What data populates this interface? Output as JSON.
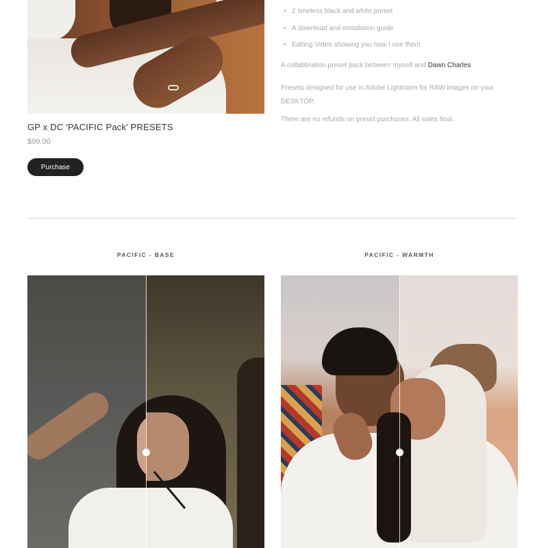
{
  "product": {
    "title": "GP x DC 'PACIFIC Pack' PRESETS",
    "price": "$99.00",
    "purchase_label": "Purchase"
  },
  "description": {
    "list_items": [
      "2 timeless black and white preset",
      "A download and installation guide",
      "Editing Video showing you how I use them"
    ],
    "collab_text": "A collabbration preset pack between myself and ",
    "collab_link": "Dawn Charles",
    "usage_text": "Presets designed for use in Adobe Lightroom for RAW images on your DESKTOP.",
    "refund_text": "There are no refunds on preset purchases. All sales final."
  },
  "comparisons": [
    {
      "label": "PACIFIC - BASE",
      "slider_position": 0.5
    },
    {
      "label": "PACIFIC - WARMTH",
      "slider_position": 0.5
    }
  ],
  "colors": {
    "button_bg": "#222222",
    "link": "#333333",
    "muted_text": "#a9a9a9",
    "divider": "#dcdcdc"
  }
}
